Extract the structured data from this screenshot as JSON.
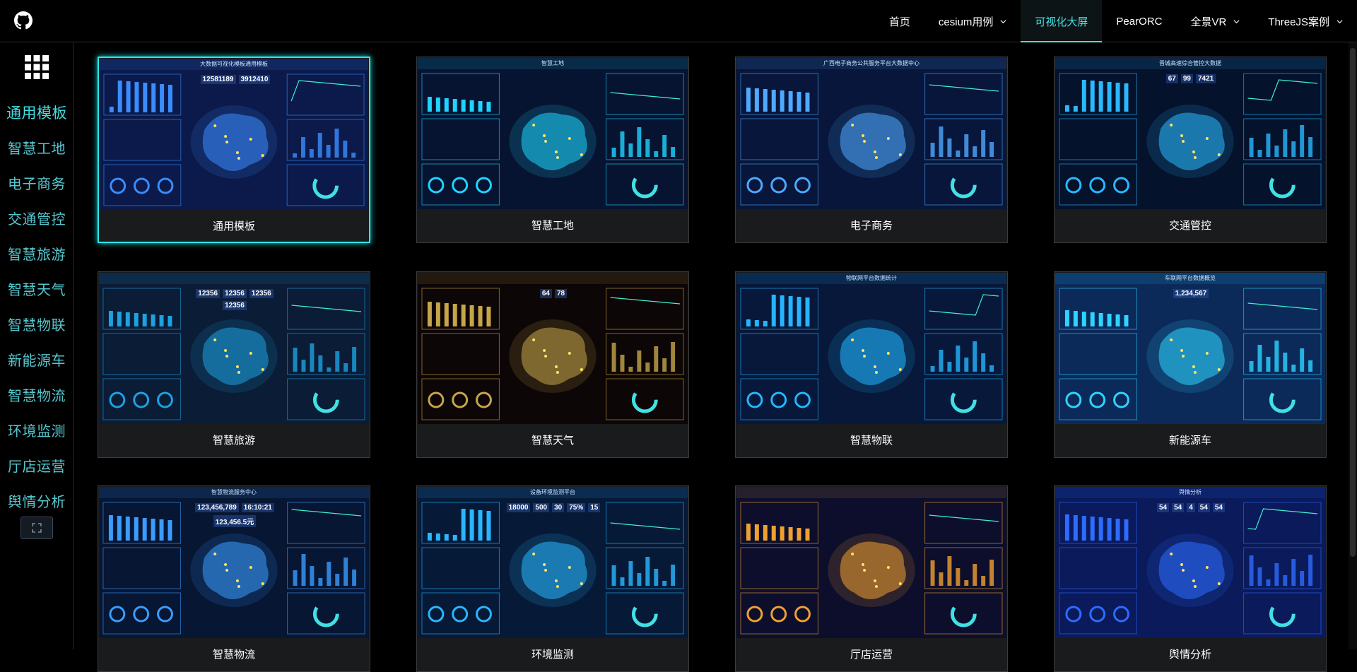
{
  "nav": {
    "items": [
      {
        "label": "首页",
        "dropdown": false,
        "active": false
      },
      {
        "label": "cesium用例",
        "dropdown": true,
        "active": false
      },
      {
        "label": "可视化大屏",
        "dropdown": false,
        "active": true
      },
      {
        "label": "PearORC",
        "dropdown": false,
        "active": false
      },
      {
        "label": "全景VR",
        "dropdown": true,
        "active": false
      },
      {
        "label": "ThreeJS案例",
        "dropdown": true,
        "active": false
      }
    ]
  },
  "sidebar": {
    "items": [
      {
        "label": "通用模板",
        "active": true
      },
      {
        "label": "智慧工地",
        "active": false
      },
      {
        "label": "电子商务",
        "active": false
      },
      {
        "label": "交通管控",
        "active": false
      },
      {
        "label": "智慧旅游",
        "active": false
      },
      {
        "label": "智慧天气",
        "active": false
      },
      {
        "label": "智慧物联",
        "active": false
      },
      {
        "label": "新能源车",
        "active": false
      },
      {
        "label": "智慧物流",
        "active": false
      },
      {
        "label": "环境监测",
        "active": false
      },
      {
        "label": "厅店运营",
        "active": false
      },
      {
        "label": "舆情分析",
        "active": false
      }
    ]
  },
  "cards": [
    {
      "label": "通用模板",
      "active": true,
      "theme": "#0b1a4a",
      "accent": "#3a8dff",
      "thumb_title": "大数据可视化模板通用模板",
      "thumb_nums": [
        "12581189",
        "3912410"
      ]
    },
    {
      "label": "智慧工地",
      "active": false,
      "theme": "#061431",
      "accent": "#1fd4ff",
      "thumb_title": "智慧工地"
    },
    {
      "label": "电子商务",
      "active": false,
      "theme": "#07163a",
      "accent": "#4fa9ff",
      "thumb_title": "广西电子商务公共服务平台大数据中心"
    },
    {
      "label": "交通管控",
      "active": false,
      "theme": "#04122c",
      "accent": "#2ab8ff",
      "thumb_title": "晋城高速综合管控大数据",
      "thumb_nums": [
        "67",
        "99",
        "7421"
      ]
    },
    {
      "label": "智慧旅游",
      "active": false,
      "theme": "#0a1c36",
      "accent": "#1da1e0",
      "thumb_nums": [
        "12356",
        "12356",
        "12356",
        "12356"
      ]
    },
    {
      "label": "智慧天气",
      "active": false,
      "theme": "#0d0606",
      "accent": "#c6a54a",
      "thumb_nums": [
        "64",
        "78"
      ]
    },
    {
      "label": "智慧物联",
      "active": false,
      "theme": "#07183a",
      "accent": "#23b6ff",
      "thumb_title": "物联网平台数据统计"
    },
    {
      "label": "新能源车",
      "active": false,
      "theme": "#0b2a5a",
      "accent": "#2dd4ff",
      "thumb_title": "车联网平台数据概览",
      "thumb_nums": [
        "1,234,567"
      ]
    },
    {
      "label": "智慧物流",
      "active": false,
      "theme": "#071633",
      "accent": "#3a9cff",
      "thumb_title": "智慧物流服务中心",
      "thumb_nums": [
        "123,456,789",
        "16:10:21",
        "123,456.5元"
      ]
    },
    {
      "label": "环境监测",
      "active": false,
      "theme": "#061a38",
      "accent": "#2ab6ff",
      "thumb_title": "设备环境监测平台",
      "thumb_nums": [
        "18000",
        "500",
        "30",
        "75%",
        "15"
      ]
    },
    {
      "label": "厅店运营",
      "active": false,
      "theme": "#0c0e2c",
      "accent": "#f0a030",
      "thumb_title": ""
    },
    {
      "label": "舆情分析",
      "active": false,
      "theme": "#0a1a5a",
      "accent": "#2e6cff",
      "thumb_title": "舆情分析",
      "thumb_nums": [
        "54",
        "54",
        "4",
        "54",
        "54"
      ]
    }
  ],
  "colors": {
    "accent": "#41e0e4",
    "sidebar_text": "#56c7cf",
    "card_bg": "#1a1b1d"
  }
}
